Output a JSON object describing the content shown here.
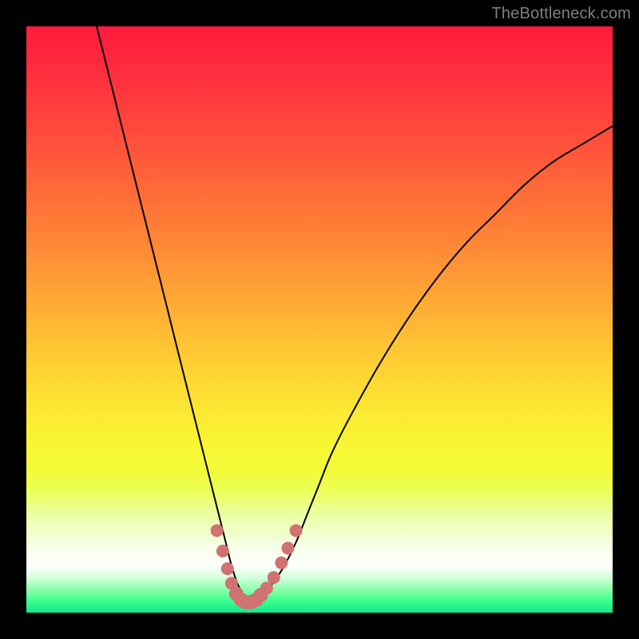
{
  "watermark": "TheBottleneck.com",
  "chart_data": {
    "type": "line",
    "title": "",
    "xlabel": "",
    "ylabel": "",
    "xlim": [
      0,
      100
    ],
    "ylim": [
      0,
      100
    ],
    "grid": false,
    "legend": false,
    "series": [
      {
        "name": "bottleneck-curve",
        "x": [
          12,
          14,
          16,
          18,
          20,
          22,
          24,
          26,
          28,
          30,
          32,
          34,
          35,
          36,
          37,
          38,
          39,
          40,
          42,
          44,
          46,
          48,
          50,
          52,
          55,
          60,
          65,
          70,
          75,
          80,
          85,
          90,
          95,
          100
        ],
        "values": [
          100,
          92,
          84,
          76,
          68,
          60,
          52,
          44,
          36,
          28,
          20,
          12,
          8,
          5,
          3,
          2,
          2,
          3,
          5,
          8,
          12,
          17,
          22,
          27,
          33,
          42,
          50,
          57,
          63,
          68,
          73,
          77,
          80,
          83
        ]
      }
    ],
    "markers": {
      "name": "optimum-band",
      "x": [
        32.5,
        33.5,
        34.3,
        35.0,
        35.8,
        36.6,
        37.4,
        38.3,
        39.2,
        40.0,
        41.0,
        42.2,
        43.5,
        44.6,
        46.0
      ],
      "values": [
        14.0,
        10.5,
        7.5,
        5.0,
        3.2,
        2.2,
        1.8,
        1.8,
        2.2,
        3.0,
        4.2,
        6.0,
        8.5,
        11.0,
        14.0
      ]
    },
    "annotations": []
  },
  "colors": {
    "background": "#000000",
    "watermark": "#7f7f7f",
    "marker": "#cf7271",
    "curve": "#000000"
  }
}
